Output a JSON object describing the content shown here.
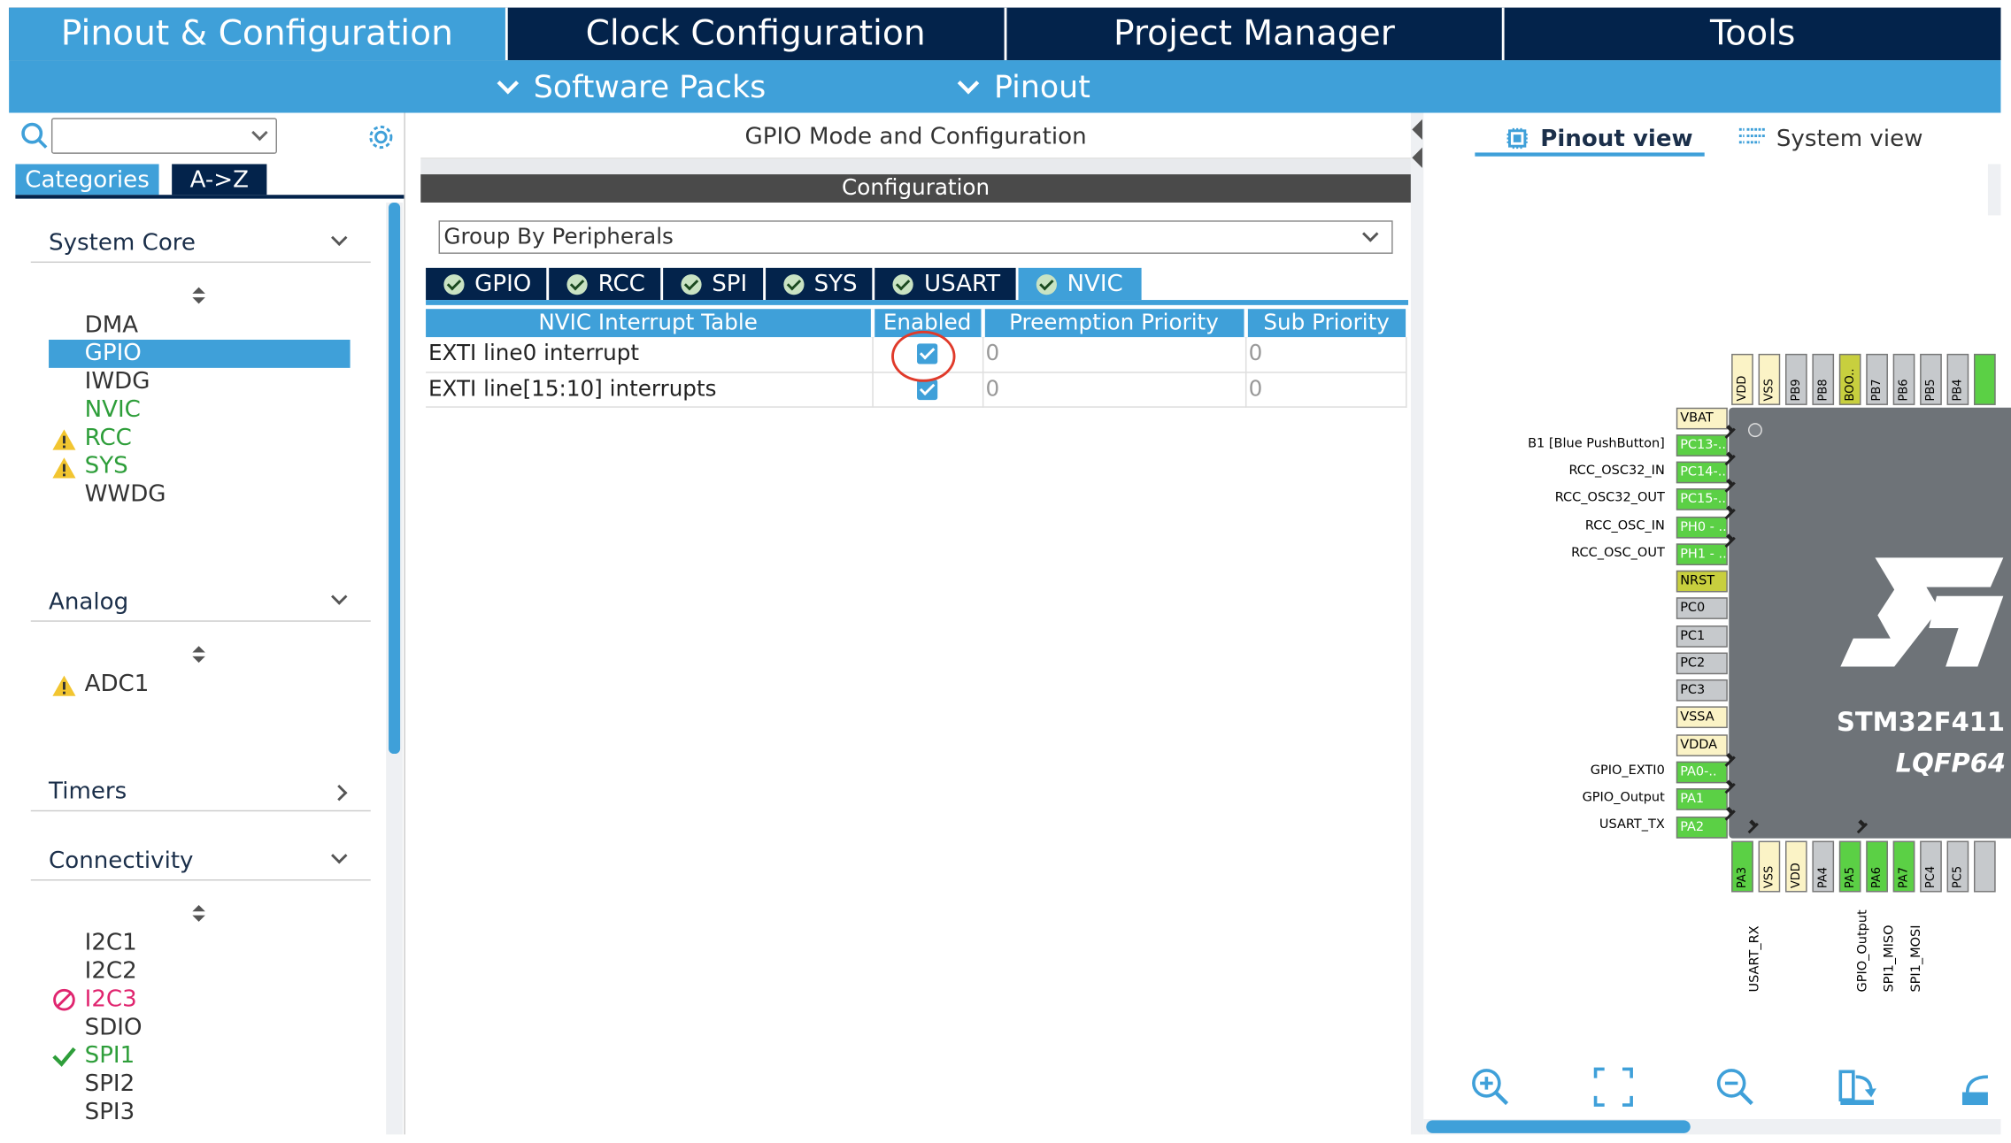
{
  "top_tabs": [
    "Pinout & Configuration",
    "Clock Configuration",
    "Project Manager",
    "Tools"
  ],
  "sub_menu": [
    "Software Packs",
    "Pinout"
  ],
  "left": {
    "cat_tabs": [
      "Categories",
      "A->Z"
    ],
    "sections": {
      "system_core": {
        "title": "System Core",
        "items": [
          "DMA",
          "GPIO",
          "IWDG",
          "NVIC",
          "RCC",
          "SYS",
          "WWDG"
        ]
      },
      "analog": {
        "title": "Analog",
        "items": [
          "ADC1"
        ]
      },
      "timers": {
        "title": "Timers"
      },
      "connectivity": {
        "title": "Connectivity",
        "items": [
          "I2C1",
          "I2C2",
          "I2C3",
          "SDIO",
          "SPI1",
          "SPI2",
          "SPI3"
        ]
      }
    }
  },
  "middle": {
    "title": "GPIO Mode and Configuration",
    "config_label": "Configuration",
    "group_select": "Group By Peripherals",
    "periph_tabs": [
      "GPIO",
      "RCC",
      "SPI",
      "SYS",
      "USART",
      "NVIC"
    ],
    "table": {
      "headers": [
        "NVIC Interrupt Table",
        "Enabled",
        "Preemption Priority",
        "Sub Priority"
      ],
      "rows": [
        {
          "name": "EXTI line0 interrupt",
          "enabled": true,
          "preemption": "0",
          "sub": "0"
        },
        {
          "name": "EXTI line[15:10] interrupts",
          "enabled": true,
          "preemption": "0",
          "sub": "0"
        }
      ]
    }
  },
  "right": {
    "view_tabs": [
      "Pinout view",
      "System view"
    ],
    "chip_name": "STM32F411",
    "chip_package": "LQFP64",
    "top_pins": [
      "VDD",
      "VSS",
      "PB9",
      "PB8",
      "BOO..",
      "PB7",
      "PB6",
      "PB5",
      "PB4"
    ],
    "left_pins": [
      "VBAT",
      "PC13-..",
      "PC14-..",
      "PC15-..",
      "PH0 - ..",
      "PH1 - ..",
      "NRST",
      "PC0",
      "PC1",
      "PC2",
      "PC3",
      "VSSA",
      "VDDA",
      "PA0-..",
      "PA1",
      "PA2"
    ],
    "left_signals": [
      "",
      "B1 [Blue PushButton]",
      "RCC_OSC32_IN",
      "RCC_OSC32_OUT",
      "RCC_OSC_IN",
      "RCC_OSC_OUT",
      "",
      "",
      "",
      "",
      "",
      "",
      "",
      "GPIO_EXTI0",
      "GPIO_Output",
      "USART_TX"
    ],
    "bottom_pins": [
      "PA3",
      "VSS",
      "VDD",
      "PA4",
      "PA5",
      "PA6",
      "PA7",
      "PC4",
      "PC5"
    ],
    "bottom_signals": [
      "USART_RX",
      "",
      "",
      "",
      "GPIO_Output",
      "SPI1_MISO",
      "SPI1_MOSI",
      "",
      ""
    ]
  },
  "colors": {
    "accent": "#3fa0d9",
    "navy": "#03234b",
    "pin_green": "#5bd045",
    "pin_yellow": "#fbf3c6",
    "pin_gray": "#c6c9cc",
    "warn": "#f2c530",
    "error": "#e0256f"
  }
}
